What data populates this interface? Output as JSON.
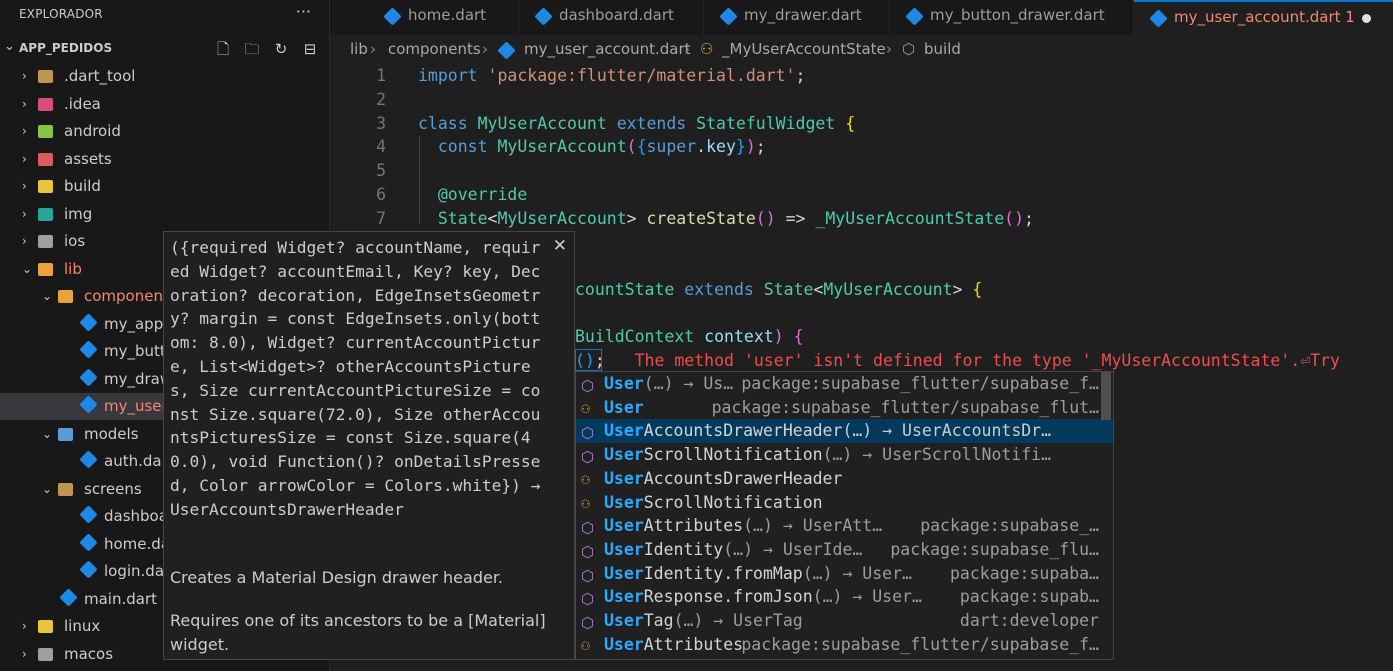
{
  "explorer": {
    "title": "EXPLORADOR",
    "more": "···",
    "project": "APP_PEDIDOS",
    "items": [
      {
        "label": ".dart_tool",
        "color": "#c09553",
        "level": 0,
        "chev": "›"
      },
      {
        "label": ".idea",
        "color": "#d64f7a",
        "level": 0,
        "chev": "›"
      },
      {
        "label": "android",
        "color": "#8bc34a",
        "level": 0,
        "chev": "›"
      },
      {
        "label": "assets",
        "color": "#d95d5d",
        "level": 0,
        "chev": "›"
      },
      {
        "label": "build",
        "color": "#e8c33c",
        "level": 0,
        "chev": "›"
      },
      {
        "label": "img",
        "color": "#26a69a",
        "level": 0,
        "chev": "›"
      },
      {
        "label": "ios",
        "color": "#9e9e9e",
        "level": 0,
        "chev": "›"
      },
      {
        "label": "lib",
        "color": "#e8a33c",
        "level": 0,
        "chev": "⌄",
        "red": true
      },
      {
        "label": "components",
        "color": "#e8a33c",
        "level": 1,
        "chev": "⌄",
        "red": true
      },
      {
        "label": "my_appbar",
        "level": 2,
        "dart": true
      },
      {
        "label": "my_button",
        "level": 2,
        "dart": true
      },
      {
        "label": "my_drawer",
        "level": 2,
        "dart": true
      },
      {
        "label": "my_user_ac",
        "level": 2,
        "dart": true,
        "red": true,
        "selected": true
      },
      {
        "label": "models",
        "color": "#5c9bd6",
        "level": 1,
        "chev": "⌄"
      },
      {
        "label": "auth.dart",
        "level": 2,
        "dart": true
      },
      {
        "label": "screens",
        "color": "#c09553",
        "level": 1,
        "chev": "⌄"
      },
      {
        "label": "dashboard.",
        "level": 2,
        "dart": true
      },
      {
        "label": "home.dart",
        "level": 2,
        "dart": true
      },
      {
        "label": "login.dart",
        "level": 2,
        "dart": true
      },
      {
        "label": "main.dart",
        "level": 1,
        "dart": true
      },
      {
        "label": "linux",
        "color": "#e8c33c",
        "level": 0,
        "chev": "›"
      },
      {
        "label": "macos",
        "color": "#9e9e9e",
        "level": 0,
        "chev": "›"
      }
    ]
  },
  "tabs": [
    {
      "label": "home.dart",
      "active": false
    },
    {
      "label": "dashboard.dart",
      "active": false
    },
    {
      "label": "my_drawer.dart",
      "active": false
    },
    {
      "label": "my_button_drawer.dart",
      "active": false
    },
    {
      "label": "my_user_account.dart 1",
      "active": true
    }
  ],
  "breadcrumb": [
    "lib",
    "components",
    "my_user_account.dart",
    "_MyUserAccountState",
    "build"
  ],
  "line_numbers": [
    "1",
    "2",
    "3",
    "4",
    "5",
    "6",
    "7"
  ],
  "code": {
    "l1_kw": "import",
    "l1_str": "'package:flutter/material.dart'",
    "l3_class": "class",
    "l3_name": "MyUserAccount",
    "l3_extends": "extends",
    "l3_super": "StatefulWidget",
    "l4_const": "const",
    "l4_name": "MyUserAccount",
    "l4_super": "super",
    "l4_key": "key",
    "l6_ann": "@override",
    "l7_state": "State",
    "l7_type": "MyUserAccount",
    "l7_fn": "createState",
    "l7_arrow": "=>",
    "l7_ret": "_MyUserAccountState",
    "l9_frag": "countState",
    "l9_extends": "extends",
    "l9_state": "State",
    "l9_type": "MyUserAccount",
    "l10_ctx": "BuildContext",
    "l10_var": "context",
    "l11_paren": "()",
    "l11_semi": ";",
    "l11_error": "The method 'user' isn't defined for the type '_MyUserAccountState'.⏎Try"
  },
  "hover": {
    "signature": "({required Widget? accountName, required Widget? accountEmail, Key? key, Decoration? decoration, EdgeInsetsGeometry? margin = const EdgeInsets.only(bottom: 8.0), Widget? currentAccountPicture, List<Widget>? otherAccountsPictures, Size currentAccountPictureSize = const Size.square(72.0), Size otherAccountsPicturesSize = const Size.square(40.0), void Function()? onDetailsPressed, Color arrowColor = Colors.white}) → UserAccountsDrawerHeader",
    "close": "✕",
    "doc_1": "Creates a Material Design drawer header.",
    "doc_2": "Requires one of its ancestors to be a [Material] widget."
  },
  "suggestions": [
    {
      "match": "User",
      "rest": "",
      "detail": "(…) → Us…",
      "source": "package:supabase_flutter/supabase_f…",
      "icon": "cube"
    },
    {
      "match": "User",
      "rest": "",
      "detail": "",
      "source": "package:supabase_flutter/supabase_flut…",
      "icon": "sym"
    },
    {
      "match": "User",
      "rest": "AccountsDrawerHeader",
      "detail": "(…) → UserAccountsDr…",
      "source": "",
      "icon": "cube",
      "selected": true
    },
    {
      "match": "User",
      "rest": "ScrollNotification",
      "detail": "(…) → UserScrollNotifi…",
      "source": "",
      "icon": "cube"
    },
    {
      "match": "User",
      "rest": "AccountsDrawerHeader",
      "detail": "",
      "source": "",
      "icon": "sym"
    },
    {
      "match": "User",
      "rest": "ScrollNotification",
      "detail": "",
      "source": "",
      "icon": "sym"
    },
    {
      "match": "User",
      "rest": "Attributes",
      "detail": "(…) → UserAtt…",
      "source": "package:supabase_…",
      "icon": "cube"
    },
    {
      "match": "User",
      "rest": "Identity",
      "detail": "(…) → UserIde…",
      "source": "package:supabase_flu…",
      "icon": "cube"
    },
    {
      "match": "User",
      "rest": "Identity.fromMap",
      "detail": "(…) → User…",
      "source": "package:supaba…",
      "icon": "cube"
    },
    {
      "match": "User",
      "rest": "Response.fromJson",
      "detail": "(…) → User…",
      "source": "package:supab…",
      "icon": "cube"
    },
    {
      "match": "User",
      "rest": "Tag",
      "detail": "(…) → UserTag",
      "source": "dart:developer",
      "icon": "cube"
    },
    {
      "match": "User",
      "rest": "Attributes",
      "detail": "",
      "source": "package:supabase_flutter/supabase_f…",
      "icon": "sym"
    }
  ],
  "colors": {
    "accent": "#0078d4",
    "error": "#f14c4c",
    "modified": "#f48771"
  }
}
